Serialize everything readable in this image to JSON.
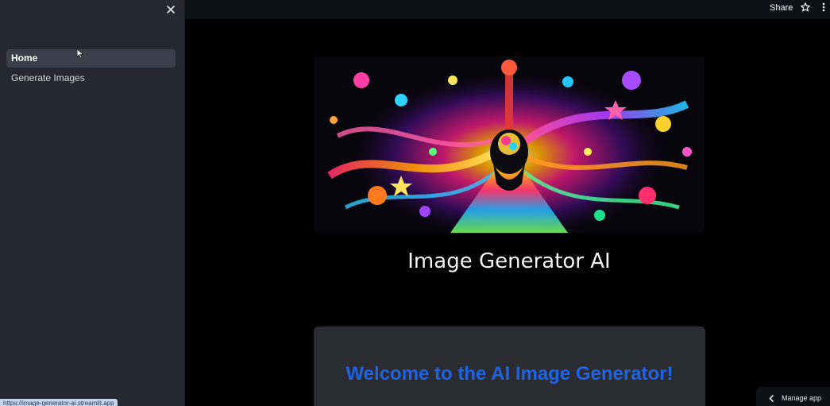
{
  "sidebar": {
    "items": [
      {
        "label": "Home",
        "active": true
      },
      {
        "label": "Generate Images",
        "active": false
      }
    ]
  },
  "header": {
    "share_label": "Share"
  },
  "main": {
    "title": "Image Generator AI",
    "welcome_heading": "Welcome to the AI Image Generator!"
  },
  "footer": {
    "manage_app_label": "Manage app",
    "status_url": "https://image-generator-ai.streamlit.app"
  },
  "colors": {
    "sidebar_bg": "#262730",
    "accent_blue": "#1e62e6"
  },
  "icons": {
    "close": "close-icon",
    "star": "star-icon",
    "menu": "kebab-menu-icon",
    "chevron": "chevron-left-icon",
    "cursor": "mouse-pointer-icon"
  }
}
